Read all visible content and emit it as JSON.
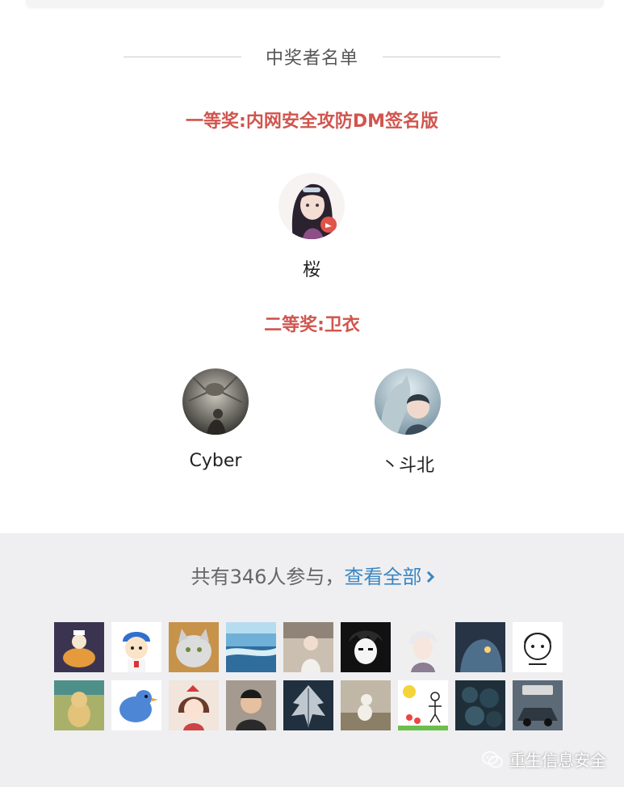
{
  "section": {
    "title": "中奖者名单"
  },
  "prizes": [
    {
      "title": "一等奖:内网安全攻防DM签名版",
      "winners": [
        {
          "name": "桜"
        }
      ]
    },
    {
      "title": "二等奖:卫衣",
      "winners": [
        {
          "name": "Cyber"
        },
        {
          "name": "丶斗北"
        }
      ]
    }
  ],
  "participants": {
    "text": "共有346人参与，",
    "link": "查看全部"
  },
  "watermark": {
    "text": "重生信息安全"
  },
  "colors": {
    "prize_red": "#d0554e",
    "link_blue": "#3b87c2",
    "footer_bg": "#efeff1"
  },
  "icons": {
    "watermark": "wechat-icon",
    "link": "chevron-right-icon"
  }
}
